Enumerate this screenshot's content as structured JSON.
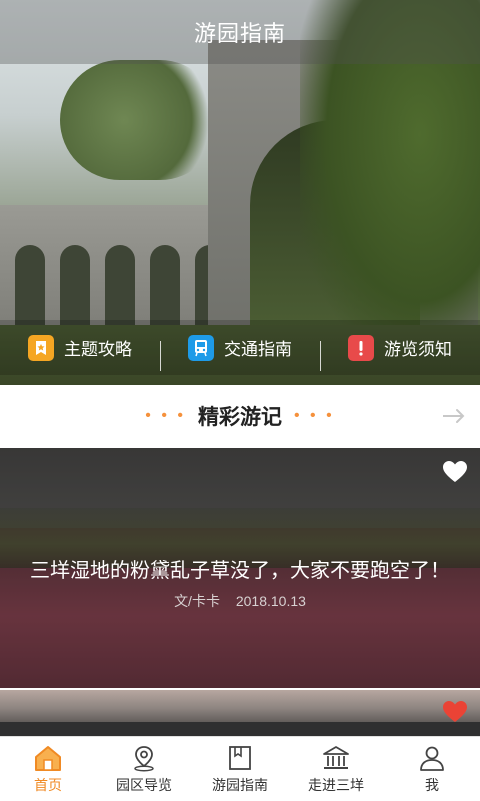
{
  "header": {
    "title": "游园指南"
  },
  "quick_links": [
    {
      "label": "主题攻略",
      "icon": "star-badge-icon",
      "color": "#f5a623"
    },
    {
      "label": "交通指南",
      "icon": "bus-icon",
      "color": "#1e9be8"
    },
    {
      "label": "游览须知",
      "icon": "exclamation-icon",
      "color": "#e84a4a"
    }
  ],
  "section": {
    "title": "精彩游记",
    "dots_left": "• • •",
    "dots_right": "• • •",
    "more_icon": "arrow-right-icon"
  },
  "articles": [
    {
      "title": "三垟湿地的粉黛乱子草没了，大家不要跑空了！",
      "author": "文/卡卡",
      "date": "2018.10.13",
      "liked": false
    },
    {
      "liked": true
    }
  ],
  "tabs": [
    {
      "label": "首页",
      "icon": "home-icon",
      "active": true
    },
    {
      "label": "园区导览",
      "icon": "map-pin-icon",
      "active": false
    },
    {
      "label": "游园指南",
      "icon": "guide-book-icon",
      "active": false
    },
    {
      "label": "走进三垟",
      "icon": "museum-icon",
      "active": false
    },
    {
      "label": "我",
      "icon": "user-icon",
      "active": false
    }
  ],
  "colors": {
    "accent": "#f08a24",
    "heart_active": "#ea4335",
    "heart_inactive": "#ffffff"
  }
}
